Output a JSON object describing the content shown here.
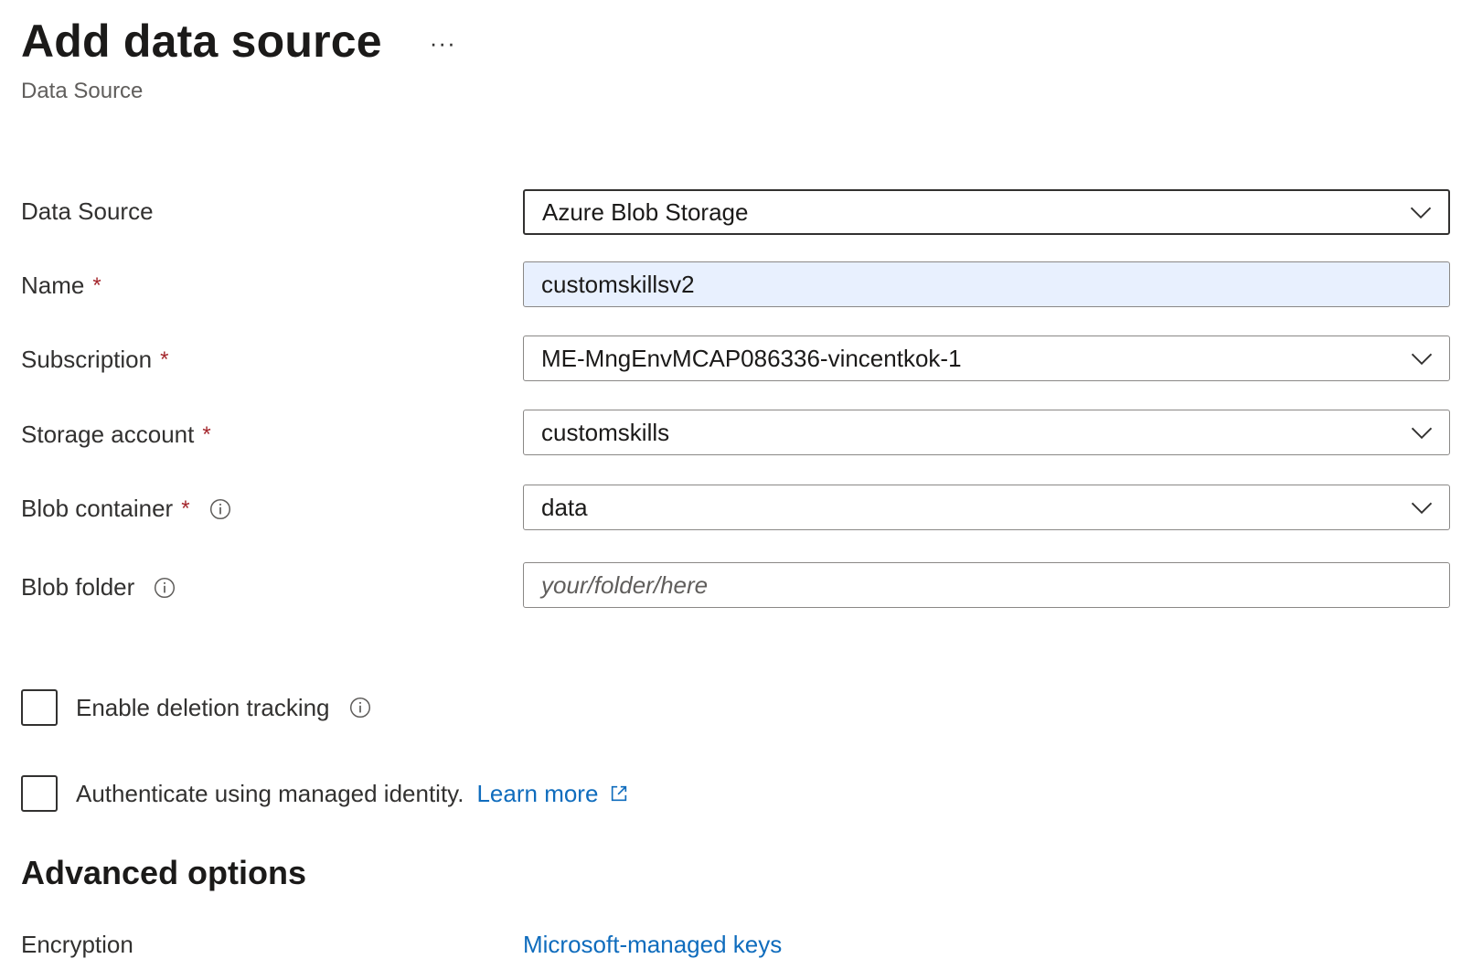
{
  "header": {
    "title": "Add data source",
    "more_label": "···",
    "subtitle": "Data Source"
  },
  "form": {
    "data_source": {
      "label": "Data Source",
      "value": "Azure Blob Storage"
    },
    "name": {
      "label": "Name",
      "required_mark": "*",
      "value": "customskillsv2"
    },
    "subscription": {
      "label": "Subscription",
      "required_mark": "*",
      "value": "ME-MngEnvMCAP086336-vincentkok-1"
    },
    "storage_account": {
      "label": "Storage account",
      "required_mark": "*",
      "value": "customskills"
    },
    "blob_container": {
      "label": "Blob container",
      "required_mark": "*",
      "value": "data"
    },
    "blob_folder": {
      "label": "Blob folder",
      "placeholder": "your/folder/here",
      "value": ""
    }
  },
  "options": {
    "deletion_tracking": {
      "label": "Enable deletion tracking",
      "checked": false
    },
    "managed_identity": {
      "label": "Authenticate using managed identity.",
      "link_label": "Learn more",
      "checked": false
    }
  },
  "advanced": {
    "title": "Advanced options",
    "encryption_label": "Encryption",
    "encryption_value": "Microsoft-managed keys"
  },
  "colors": {
    "accent_link": "#0f6cbd",
    "required": "#a4262c",
    "autofill_background": "#e8f0fe",
    "border": "#8a8886"
  },
  "icons": {
    "dropdown": "chevron-down-icon",
    "info": "info-icon",
    "external": "external-link-icon",
    "more": "ellipsis-icon"
  }
}
